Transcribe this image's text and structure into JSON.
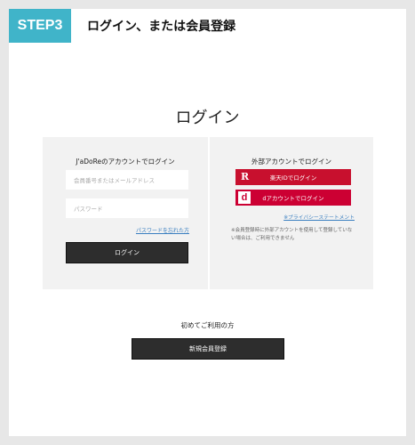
{
  "header": {
    "step": "STEP3",
    "title": "ログイン、または会員登録"
  },
  "page_title": "ログイン",
  "member_login": {
    "title": "J'aDoReのアカウントでログイン",
    "id_placeholder": "会員番号またはメールアドレス",
    "password_placeholder": "パスワード",
    "forgot_link": "パスワードを忘れた方",
    "login_button": "ログイン"
  },
  "external_login": {
    "title": "外部アカウントでログイン",
    "rakuten_icon": "R",
    "rakuten_button": "楽天IDでログイン",
    "docomo_icon": "d",
    "docomo_button": "dアカウントでログイン",
    "privacy_link": "※プライバシーステートメント",
    "note": "※会員登録時に外部アカウントを使用して登録していない場合は、ご利用できません"
  },
  "register": {
    "label": "初めてご利用の方",
    "button": "新規会員登録"
  },
  "colors": {
    "step_badge": "#40b4c9",
    "rakuten": "#c8102e",
    "docomo": "#cc0033",
    "dark_button": "#2d2d2d",
    "link": "#3a7fc0"
  }
}
